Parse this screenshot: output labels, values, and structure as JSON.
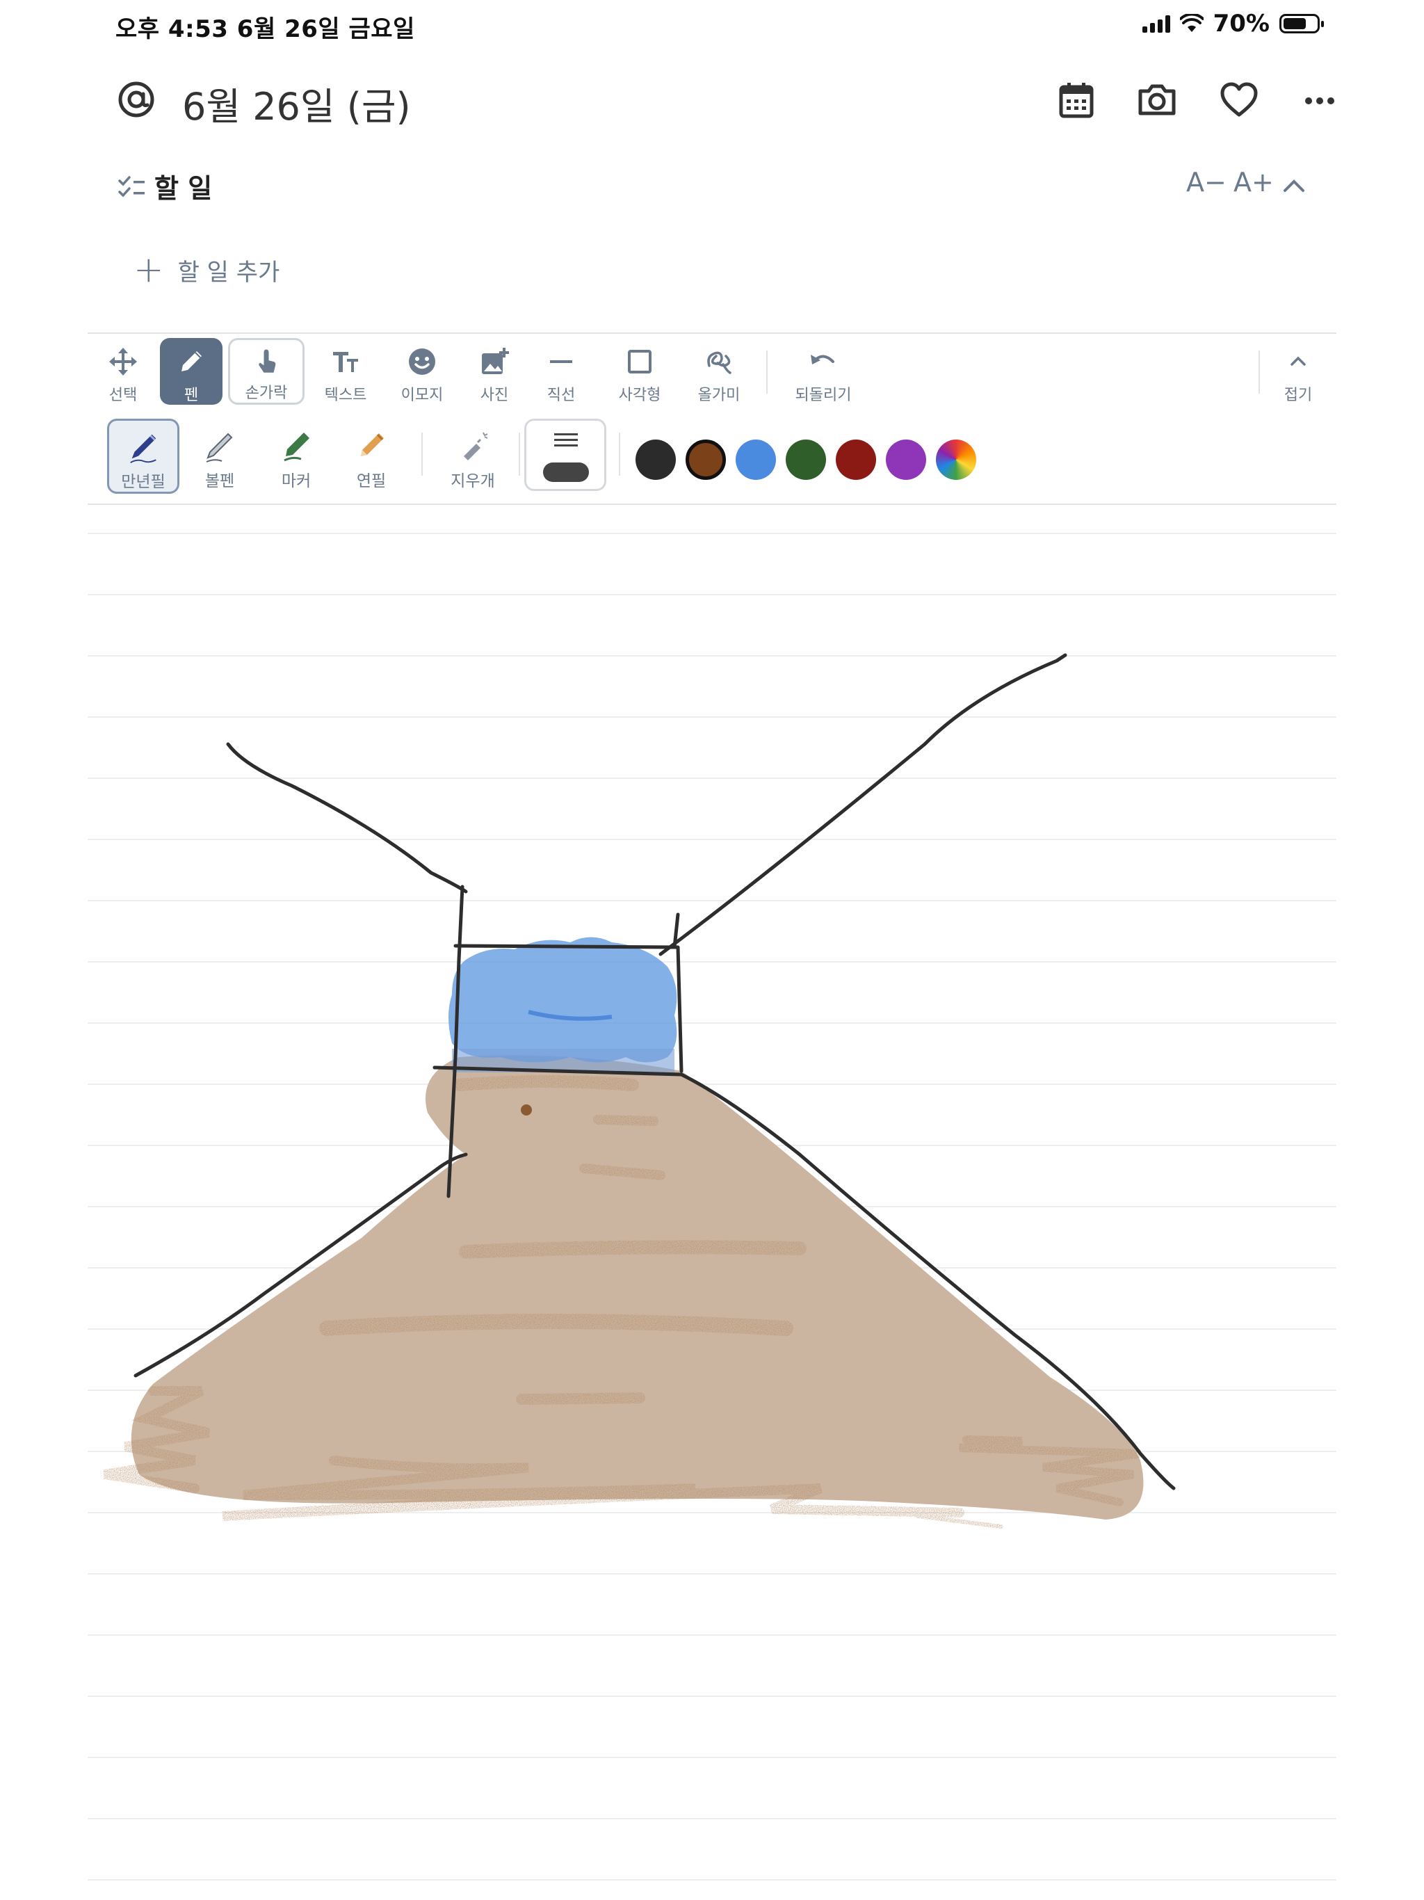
{
  "status_bar": {
    "time_date": "오후 4:53   6월 26일 금요일",
    "battery_text": "70%",
    "battery_level": 0.7
  },
  "header": {
    "title": "6월 26일 (금)",
    "icons": [
      "at-sign-icon",
      "calendar-icon",
      "camera-icon",
      "heart-icon",
      "more-icon"
    ]
  },
  "todo": {
    "section_title": "할 일",
    "font_decrease": "A−",
    "font_increase": "A+",
    "add_label": "할 일 추가"
  },
  "toolbar": {
    "tools": [
      {
        "name": "select",
        "label": "선택",
        "icon": "move-arrows-icon"
      },
      {
        "name": "pen",
        "label": "펜",
        "icon": "pencil-icon",
        "active": true
      },
      {
        "name": "finger",
        "label": "손가락",
        "icon": "finger-touch-icon"
      },
      {
        "name": "text",
        "label": "텍스트",
        "icon": "text-size-icon"
      },
      {
        "name": "emoji",
        "label": "이모지",
        "icon": "emoji-icon"
      },
      {
        "name": "photo",
        "label": "사진",
        "icon": "add-photo-icon"
      },
      {
        "name": "line",
        "label": "직선",
        "icon": "line-icon"
      },
      {
        "name": "rectangle",
        "label": "사각형",
        "icon": "square-icon"
      },
      {
        "name": "lasso",
        "label": "올가미",
        "icon": "lasso-icon"
      },
      {
        "name": "undo",
        "label": "되돌리기",
        "icon": "undo-icon"
      },
      {
        "name": "collapse",
        "label": "접기",
        "icon": "chevron-up-icon"
      }
    ]
  },
  "pen_tray": {
    "pens": [
      {
        "name": "fountain",
        "label": "만년필",
        "selected": true
      },
      {
        "name": "ballpoint",
        "label": "볼펜"
      },
      {
        "name": "marker",
        "label": "마커"
      },
      {
        "name": "pencil",
        "label": "연필"
      },
      {
        "name": "eraser",
        "label": "지우개"
      }
    ],
    "colors": [
      "#2b2b2b",
      "#7b4219",
      "#4a8be0",
      "#2f5e2b",
      "#8b1a15",
      "#8f36b8",
      "rainbow"
    ],
    "selected_color": "#7b4219"
  }
}
